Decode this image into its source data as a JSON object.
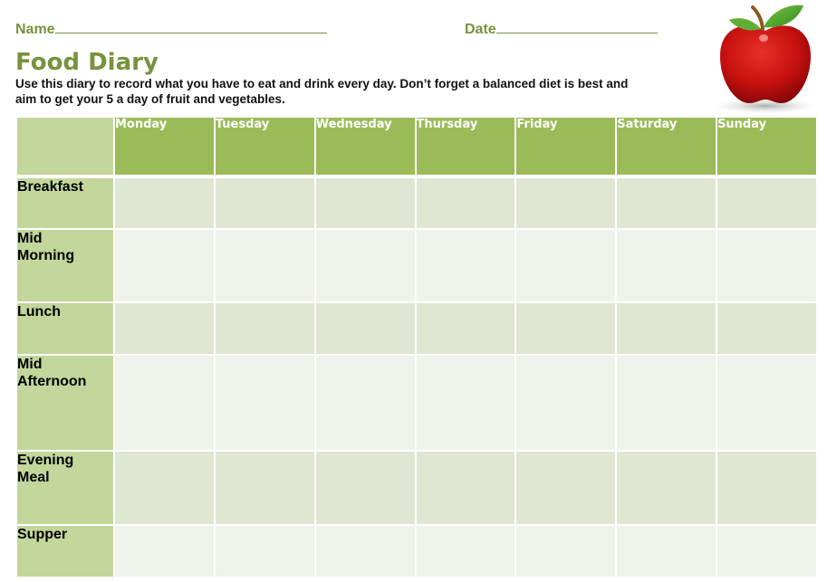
{
  "form": {
    "name_label": "Name",
    "date_label": "Date"
  },
  "title": "Food Diary",
  "intro_line1": "Use this diary to record what you have to eat and drink every day.  Don’t forget a balanced diet is best and",
  "intro_line2": "aim to get your 5 a day of fruit and vegetables.",
  "image": {
    "icon": "apple-icon",
    "description": "red apple with green leaf"
  },
  "table": {
    "days": [
      "Monday",
      "Tuesday",
      "Wednesday",
      "Thursday",
      "Friday",
      "Saturday",
      "Sunday"
    ],
    "meals": [
      {
        "line1": "Breakfast",
        "line2": ""
      },
      {
        "line1": "Mid",
        "line2": "Morning"
      },
      {
        "line1": "Lunch",
        "line2": ""
      },
      {
        "line1": "Mid",
        "line2": "Afternoon"
      },
      {
        "line1": "Evening",
        "line2": "Meal"
      },
      {
        "line1": "Supper",
        "line2": ""
      }
    ]
  },
  "colors": {
    "accent_green": "#77933c",
    "header_green": "#9bbb59",
    "meal_label_green": "#c3d69b",
    "row_band_dark": "#dfe7d3",
    "row_band_light": "#eff2ea"
  }
}
